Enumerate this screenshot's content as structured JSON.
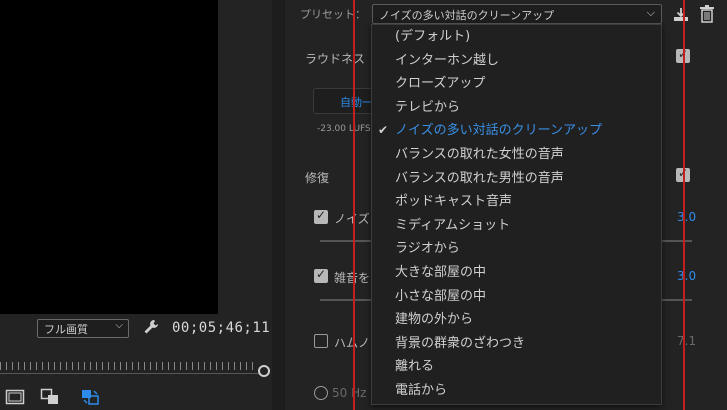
{
  "monitor": {
    "fit_label": "フル画質",
    "timecode": "00;05;46;11"
  },
  "essential_sound": {
    "preset_label": "プリセット：",
    "preset_value": "ノイズの多い対話のクリーンアップ",
    "loudness_label": "ラウドネス",
    "auto_match_label": "自動一",
    "lufs_text": "-23.00 LUFS",
    "repair_label": "修復",
    "noise_label": "ノイズを",
    "noise_value": "3.0",
    "rumble_label": "雑音を",
    "rumble_value": "3.0",
    "hum_label": "ハムノ",
    "hum_value": "7.1",
    "hz_label": "50 Hz"
  },
  "dropdown": {
    "items": [
      "(デフォルト)",
      "インターホン越し",
      "クローズアップ",
      "テレビから",
      "ノイズの多い対話のクリーンアップ",
      "バランスの取れた女性の音声",
      "バランスの取れた男性の音声",
      "ポッドキャスト音声",
      "ミディアムショット",
      "ラジオから",
      "大きな部屋の中",
      "小さな部屋の中",
      "建物の外から",
      "背景の群衆のざわつき",
      "離れる",
      "電話から"
    ],
    "selected_index": 4
  },
  "colors": {
    "accent": "#2d8ceb",
    "guide": "#c2201f"
  }
}
